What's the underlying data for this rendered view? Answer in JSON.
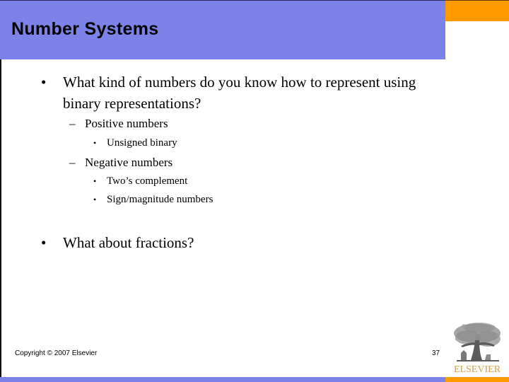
{
  "slide": {
    "title": "Number Systems",
    "bullets": [
      {
        "marker": "•",
        "lines": [
          "What kind of numbers do you know how to represent using",
          "binary representations?"
        ],
        "sub": [
          {
            "marker": "–",
            "text": "Positive numbers",
            "sub": [
              {
                "marker": "•",
                "text": "Unsigned binary"
              }
            ]
          },
          {
            "marker": "–",
            "text": "Negative numbers",
            "sub": [
              {
                "marker": "•",
                "text": "Two’s complement"
              },
              {
                "marker": "•",
                "text": "Sign/magnitude numbers"
              }
            ]
          }
        ]
      },
      {
        "marker": "•",
        "lines": [
          "What about fractions?"
        ]
      }
    ]
  },
  "footer": {
    "copyright": "Copyright © 2007 Elsevier",
    "page_number": "37",
    "logo_text": "ELSEVIER"
  },
  "colors": {
    "title_bar": "#7b82e8",
    "accent_orange": "#ff9900",
    "logo_text": "#d9a046"
  },
  "icons": {
    "logo": "elsevier-tree-logo"
  }
}
